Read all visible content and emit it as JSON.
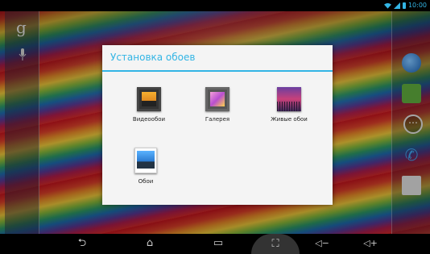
{
  "status_bar": {
    "time": "10:00"
  },
  "dialog": {
    "title": "Установка обоев",
    "options": [
      {
        "label": "Видеообои",
        "icon": "video-wallpaper-icon"
      },
      {
        "label": "Галерея",
        "icon": "gallery-icon"
      },
      {
        "label": "Живые обои",
        "icon": "live-wallpaper-icon"
      },
      {
        "label": "Обои",
        "icon": "wallpapers-icon"
      }
    ]
  },
  "search_bar": {
    "google_glyph": "g"
  },
  "nav_bar": {
    "back": "⮌",
    "home": "⌂",
    "recent": "▭",
    "screenshot": "⛶",
    "vol_down": "◁−",
    "vol_up": "◁+"
  },
  "colors": {
    "accent": "#33b5e5",
    "dialog_bg": "#f4f4f4",
    "nav_bg": "#000000"
  }
}
